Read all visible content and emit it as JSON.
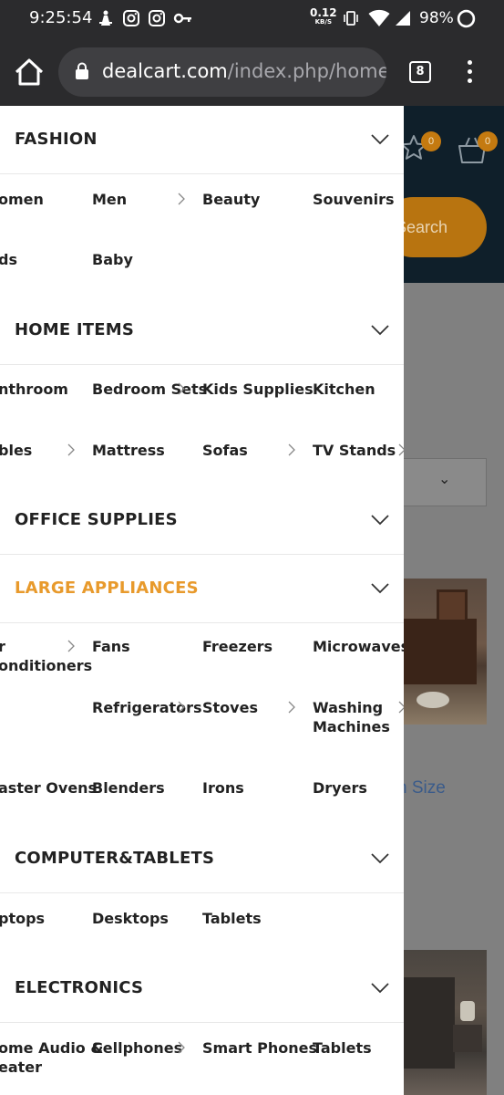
{
  "status_bar": {
    "time": "9:25:54",
    "net_speed_value": "0.12",
    "net_speed_unit": "KB/S",
    "battery_percent": "98%"
  },
  "browser": {
    "url_domain": "dealcart.com",
    "url_path": "/index.php/home-",
    "tab_count": "8"
  },
  "background_page": {
    "wishlist_count": "0",
    "cart_count": "0",
    "search_label": "Search",
    "filter_link": "n Size"
  },
  "drawer": {
    "fashion": {
      "title": "FASHION",
      "items": [
        "omen",
        "Men",
        "Beauty",
        "Souvenirs",
        "ds",
        "Baby"
      ]
    },
    "home_items": {
      "title": "HOME ITEMS",
      "items": [
        "nthroom",
        "Bedroom Sets",
        "Kids Supplies",
        "Kitchen",
        "bles",
        "Mattress",
        "Sofas",
        "TV Stands"
      ]
    },
    "office_supplies": {
      "title": "OFFICE SUPPLIES"
    },
    "large_appliances": {
      "title": "LARGE APPLIANCES",
      "items": [
        "r",
        "onditioners",
        "Fans",
        "Freezers",
        "Microwaves",
        "Refrigerators",
        "Stoves",
        "Washing",
        "Machines",
        "aster Ovens",
        "Blenders",
        "Irons",
        "Dryers"
      ]
    },
    "computer_tablets": {
      "title": "COMPUTER&TABLETS",
      "items": [
        "ptops",
        "Desktops",
        "Tablets"
      ]
    },
    "electronics": {
      "title": "ELECTRONICS",
      "items": [
        "ome Audio &",
        "eater",
        "Cellphones",
        "Smart Phones",
        "Tablets"
      ]
    }
  },
  "colors": {
    "active_section": "#e89a2c",
    "accent_button": "#b87410",
    "header_dark": "#0f1f2a"
  }
}
